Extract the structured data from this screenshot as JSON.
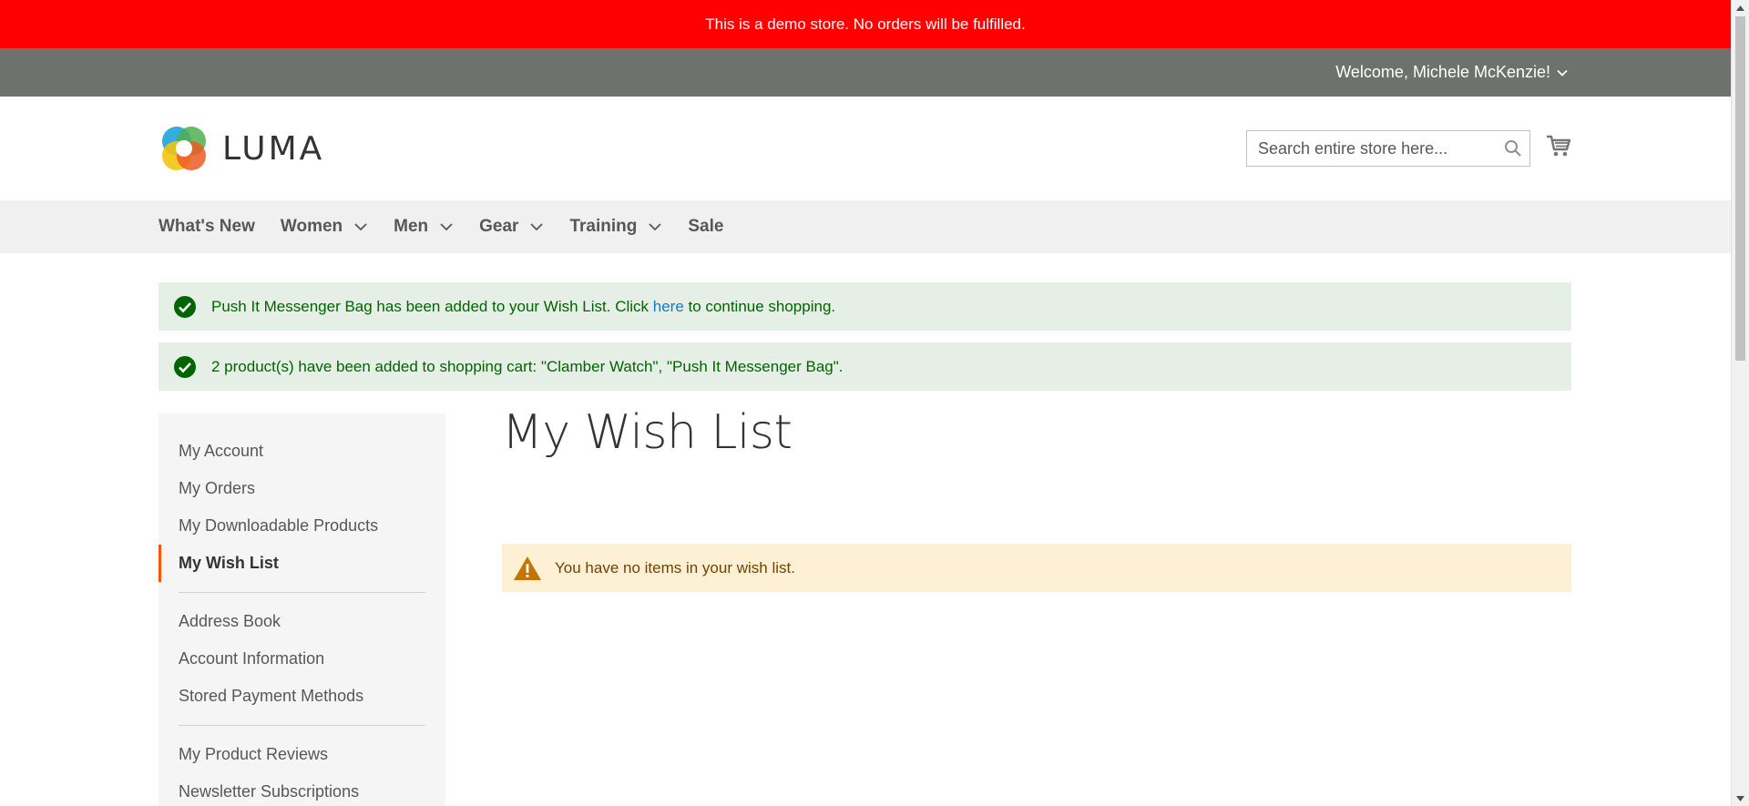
{
  "demo_notice": "This is a demo store. No orders will be fulfilled.",
  "header_panel": {
    "welcome": "Welcome, Michele McKenzie!"
  },
  "logo": {
    "text": "LUMA"
  },
  "search": {
    "placeholder": "Search entire store here..."
  },
  "nav": {
    "items": [
      {
        "label": "What's New",
        "has_submenu": false
      },
      {
        "label": "Women",
        "has_submenu": true
      },
      {
        "label": "Men",
        "has_submenu": true
      },
      {
        "label": "Gear",
        "has_submenu": true
      },
      {
        "label": "Training",
        "has_submenu": true
      },
      {
        "label": "Sale",
        "has_submenu": false
      }
    ]
  },
  "messages": {
    "wishlist_prefix": "Push It Messenger Bag has been added to your Wish List. Click ",
    "wishlist_link": "here",
    "wishlist_suffix": " to continue shopping.",
    "cart": "2 product(s) have been added to shopping cart: \"Clamber Watch\", \"Push It Messenger Bag\"."
  },
  "sidebar": {
    "group1": [
      "My Account",
      "My Orders",
      "My Downloadable Products",
      "My Wish List"
    ],
    "active": "My Wish List",
    "group2": [
      "Address Book",
      "Account Information",
      "Stored Payment Methods"
    ],
    "group3": [
      "My Product Reviews",
      "Newsletter Subscriptions"
    ]
  },
  "main": {
    "title": "My Wish List",
    "empty_notice": "You have no items in your wish list."
  },
  "colors": {
    "demo_bar": "#ff0000",
    "panel": "#6e716e",
    "success_bg": "#e5efe5",
    "success_text": "#006400",
    "warning_bg": "#fdf0d5",
    "active_accent": "#ff5501",
    "link": "#1979c3"
  }
}
